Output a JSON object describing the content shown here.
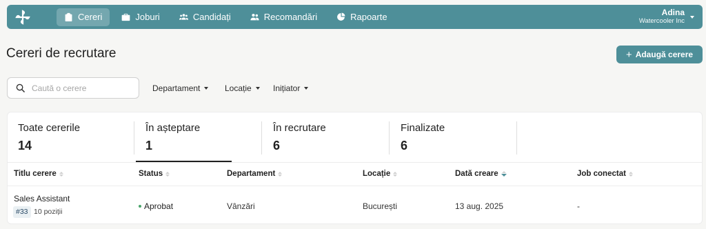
{
  "nav": {
    "items": [
      {
        "label": "Cereri",
        "icon": "clipboard-icon",
        "active": true
      },
      {
        "label": "Joburi",
        "icon": "briefcase-icon",
        "active": false
      },
      {
        "label": "Candidați",
        "icon": "users-icon",
        "active": false
      },
      {
        "label": "Recomandări",
        "icon": "user-group-icon",
        "active": false
      },
      {
        "label": "Rapoarte",
        "icon": "pie-chart-icon",
        "active": false
      }
    ]
  },
  "user": {
    "name": "Adina",
    "company": "Watercooler Inc"
  },
  "page": {
    "title": "Cereri de recrutare",
    "add_button": "Adaugă cerere"
  },
  "search": {
    "placeholder": "Caută o cerere"
  },
  "filters": [
    "Departament",
    "Locație",
    "Inițiator"
  ],
  "stats": [
    {
      "label": "Toate cererile",
      "count": "14"
    },
    {
      "label": "În așteptare",
      "count": "1"
    },
    {
      "label": "În recrutare",
      "count": "6"
    },
    {
      "label": "Finalizate",
      "count": "6"
    }
  ],
  "table": {
    "columns": [
      "Titlu cerere",
      "Status",
      "Departament",
      "Locație",
      "Dată creare",
      "Job conectat"
    ],
    "rows": [
      {
        "title": "Sales Assistant",
        "id": "#33",
        "positions": "10 poziții",
        "status": "Aprobat",
        "department": "Vânzări",
        "location": "București",
        "created": "13 aug. 2025",
        "job": "-"
      }
    ]
  },
  "colors": {
    "accent": "#4e8f99",
    "status_approved": "#49a56b"
  }
}
